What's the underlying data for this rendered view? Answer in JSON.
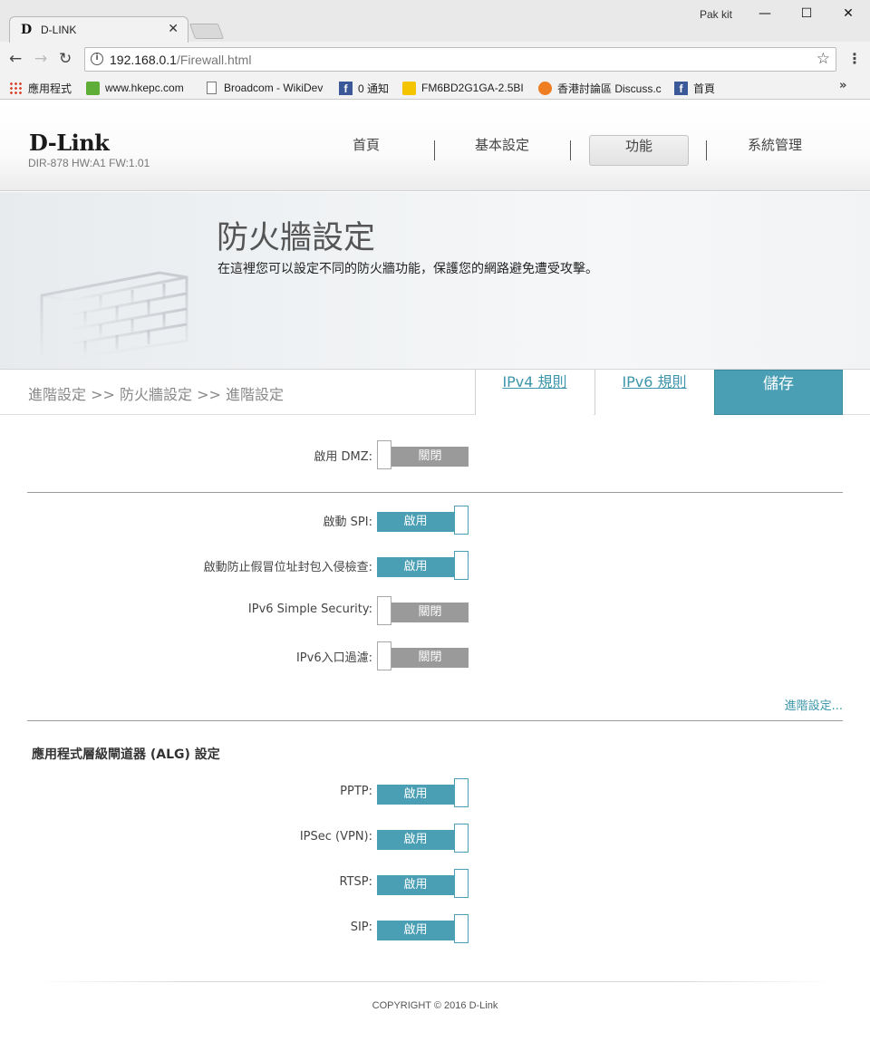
{
  "browser": {
    "tab_title": "D-LINK",
    "tab_favicon": "D",
    "user": "Pak kit",
    "url_host": "192.168.0.1",
    "url_path": "/Firewall.html",
    "bookmarks": [
      {
        "label": "應用程式",
        "icon": "apps-grid-icon"
      },
      {
        "label": "www.hkepc.com",
        "icon": "hkepc-icon"
      },
      {
        "label": "Broadcom - WikiDev",
        "icon": "page-icon"
      },
      {
        "label": "0 通知",
        "icon": "facebook-icon"
      },
      {
        "label": "FM6BD2G1GA-2.5BI",
        "icon": "fm-icon"
      },
      {
        "label": "香港討論區 Discuss.c",
        "icon": "speech-bubble-icon"
      },
      {
        "label": "首頁",
        "icon": "facebook-icon"
      }
    ]
  },
  "header": {
    "logo": "D-Link",
    "model": "DIR-878 HW:A1 FW:1.01",
    "nav": [
      "首頁",
      "基本設定",
      "功能",
      "系統管理"
    ],
    "active_nav": "功能"
  },
  "banner": {
    "title": "防火牆設定",
    "description": "在這裡您可以設定不同的防火牆功能，保護您的網路避免遭受攻擊。"
  },
  "crumbbar": {
    "breadcrumb": "進階設定 >> 防火牆設定 >> 進階設定",
    "ipv4_tab": "IPv4 規則",
    "ipv6_tab": "IPv6 規則",
    "save": "儲存"
  },
  "settings": {
    "dmz": {
      "label": "啟用 DMZ:",
      "state": "關閉"
    },
    "spi": {
      "label": "啟動 SPI:",
      "state": "啟用"
    },
    "anti_spoof": {
      "label": "啟動防止假冒位址封包入侵檢查:",
      "state": "啟用"
    },
    "ipv6_simple": {
      "label": "IPv6 Simple Security:",
      "state": "關閉"
    },
    "ipv6_ingress": {
      "label": "IPv6入口過濾:",
      "state": "關閉"
    },
    "advanced_link": "進階設定..."
  },
  "alg": {
    "title": "應用程式層級閘道器 (ALG) 設定",
    "pptp": {
      "label": "PPTP:",
      "state": "啟用"
    },
    "ipsec": {
      "label": "IPSec (VPN):",
      "state": "啟用"
    },
    "rtsp": {
      "label": "RTSP:",
      "state": "啟用"
    },
    "sip": {
      "label": "SIP:",
      "state": "啟用"
    }
  },
  "footer": {
    "copyright": "COPYRIGHT © 2016 D-Link"
  },
  "colors": {
    "accent": "#4a9fb5",
    "off": "#9a9a9a"
  }
}
